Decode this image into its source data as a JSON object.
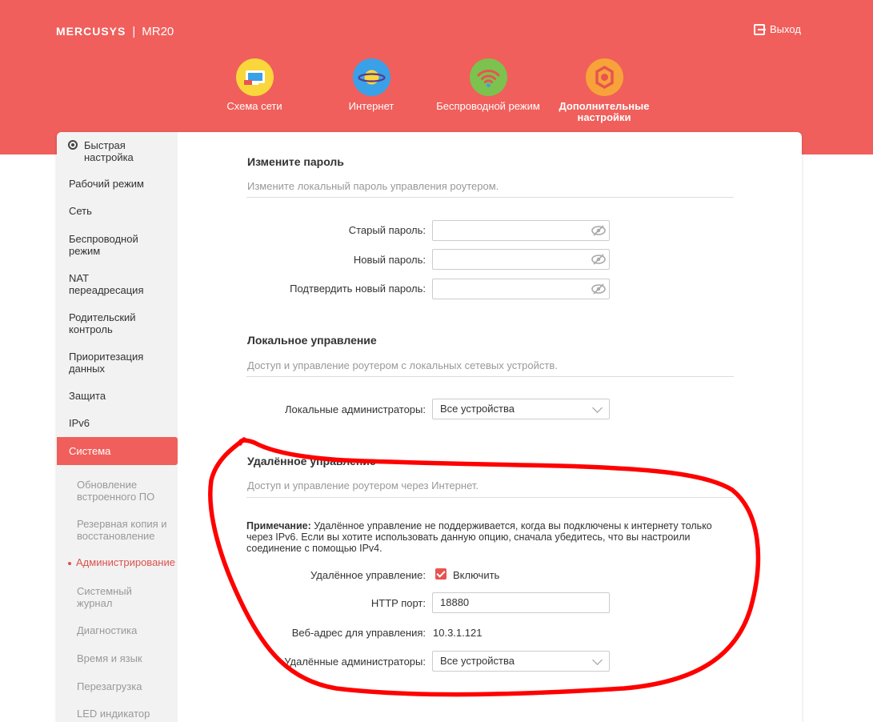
{
  "header": {
    "brand": "MERCUSYS",
    "separator": "|",
    "model": "MR20",
    "logout_label": "Выход"
  },
  "nav": {
    "tabs": [
      {
        "label": "Схема сети",
        "icon": "network-map-icon"
      },
      {
        "label": "Интернет",
        "icon": "globe-planet-icon"
      },
      {
        "label": "Беспроводной режим",
        "icon": "wifi-icon"
      },
      {
        "label": "Дополнительные настройки",
        "icon": "gear-icon"
      }
    ],
    "active_tab": "Дополнительные настройки"
  },
  "sidebar": {
    "items": [
      {
        "label": "Быстрая настройка"
      },
      {
        "label": "Рабочий режим"
      },
      {
        "label": "Сеть"
      },
      {
        "label": "Беспроводной режим"
      },
      {
        "label": "NAT переадресация"
      },
      {
        "label": "Родительский контроль"
      },
      {
        "label": "Приоритезация данных"
      },
      {
        "label": "Защита"
      },
      {
        "label": "IPv6"
      },
      {
        "label": "Система"
      }
    ],
    "subitems": [
      {
        "label": "Обновление встроенного ПО"
      },
      {
        "label": "Резервная копия и восстановление"
      },
      {
        "label": "Администрирование"
      },
      {
        "label": "Системный журнал"
      },
      {
        "label": "Диагностика"
      },
      {
        "label": "Время и язык"
      },
      {
        "label": "Перезагрузка"
      },
      {
        "label": "LED индикатор"
      }
    ]
  },
  "password_section": {
    "title": "Измените пароль",
    "description": "Измените локальный пароль управления роутером.",
    "old_label": "Старый пароль:",
    "new_label": "Новый пароль:",
    "confirm_label": "Подтвердить новый пароль:"
  },
  "local_section": {
    "title": "Локальное управление",
    "description": "Доступ и управление роутером с локальных сетевых устройств.",
    "admins_label": "Локальные администраторы:",
    "admins_value": "Все устройства"
  },
  "remote_section": {
    "title": "Удалённое управление",
    "description": "Доступ и управление роутером через Интернет.",
    "note_label": "Примечание:",
    "note_text": " Удалённое управление не поддерживается, когда вы подключены к интернету только через IPv6. Если вы хотите использовать данную опцию, сначала убедитесь, что вы настроили соединение с помощью IPv4.",
    "remote_label": "Удалённое управление:",
    "enable_label": "Включить",
    "enabled": true,
    "port_label": "HTTP порт:",
    "port_value": "18880",
    "web_address_label": "Веб-адрес для управления:",
    "web_address_value": "10.3.1.121",
    "admins_label": "Удалённые администраторы:",
    "admins_value": "Все устройства"
  },
  "colors": {
    "brand_red": "#f05f5b",
    "annotation_red": "#ff0000",
    "sidebar_bg": "#f2f2f2"
  }
}
